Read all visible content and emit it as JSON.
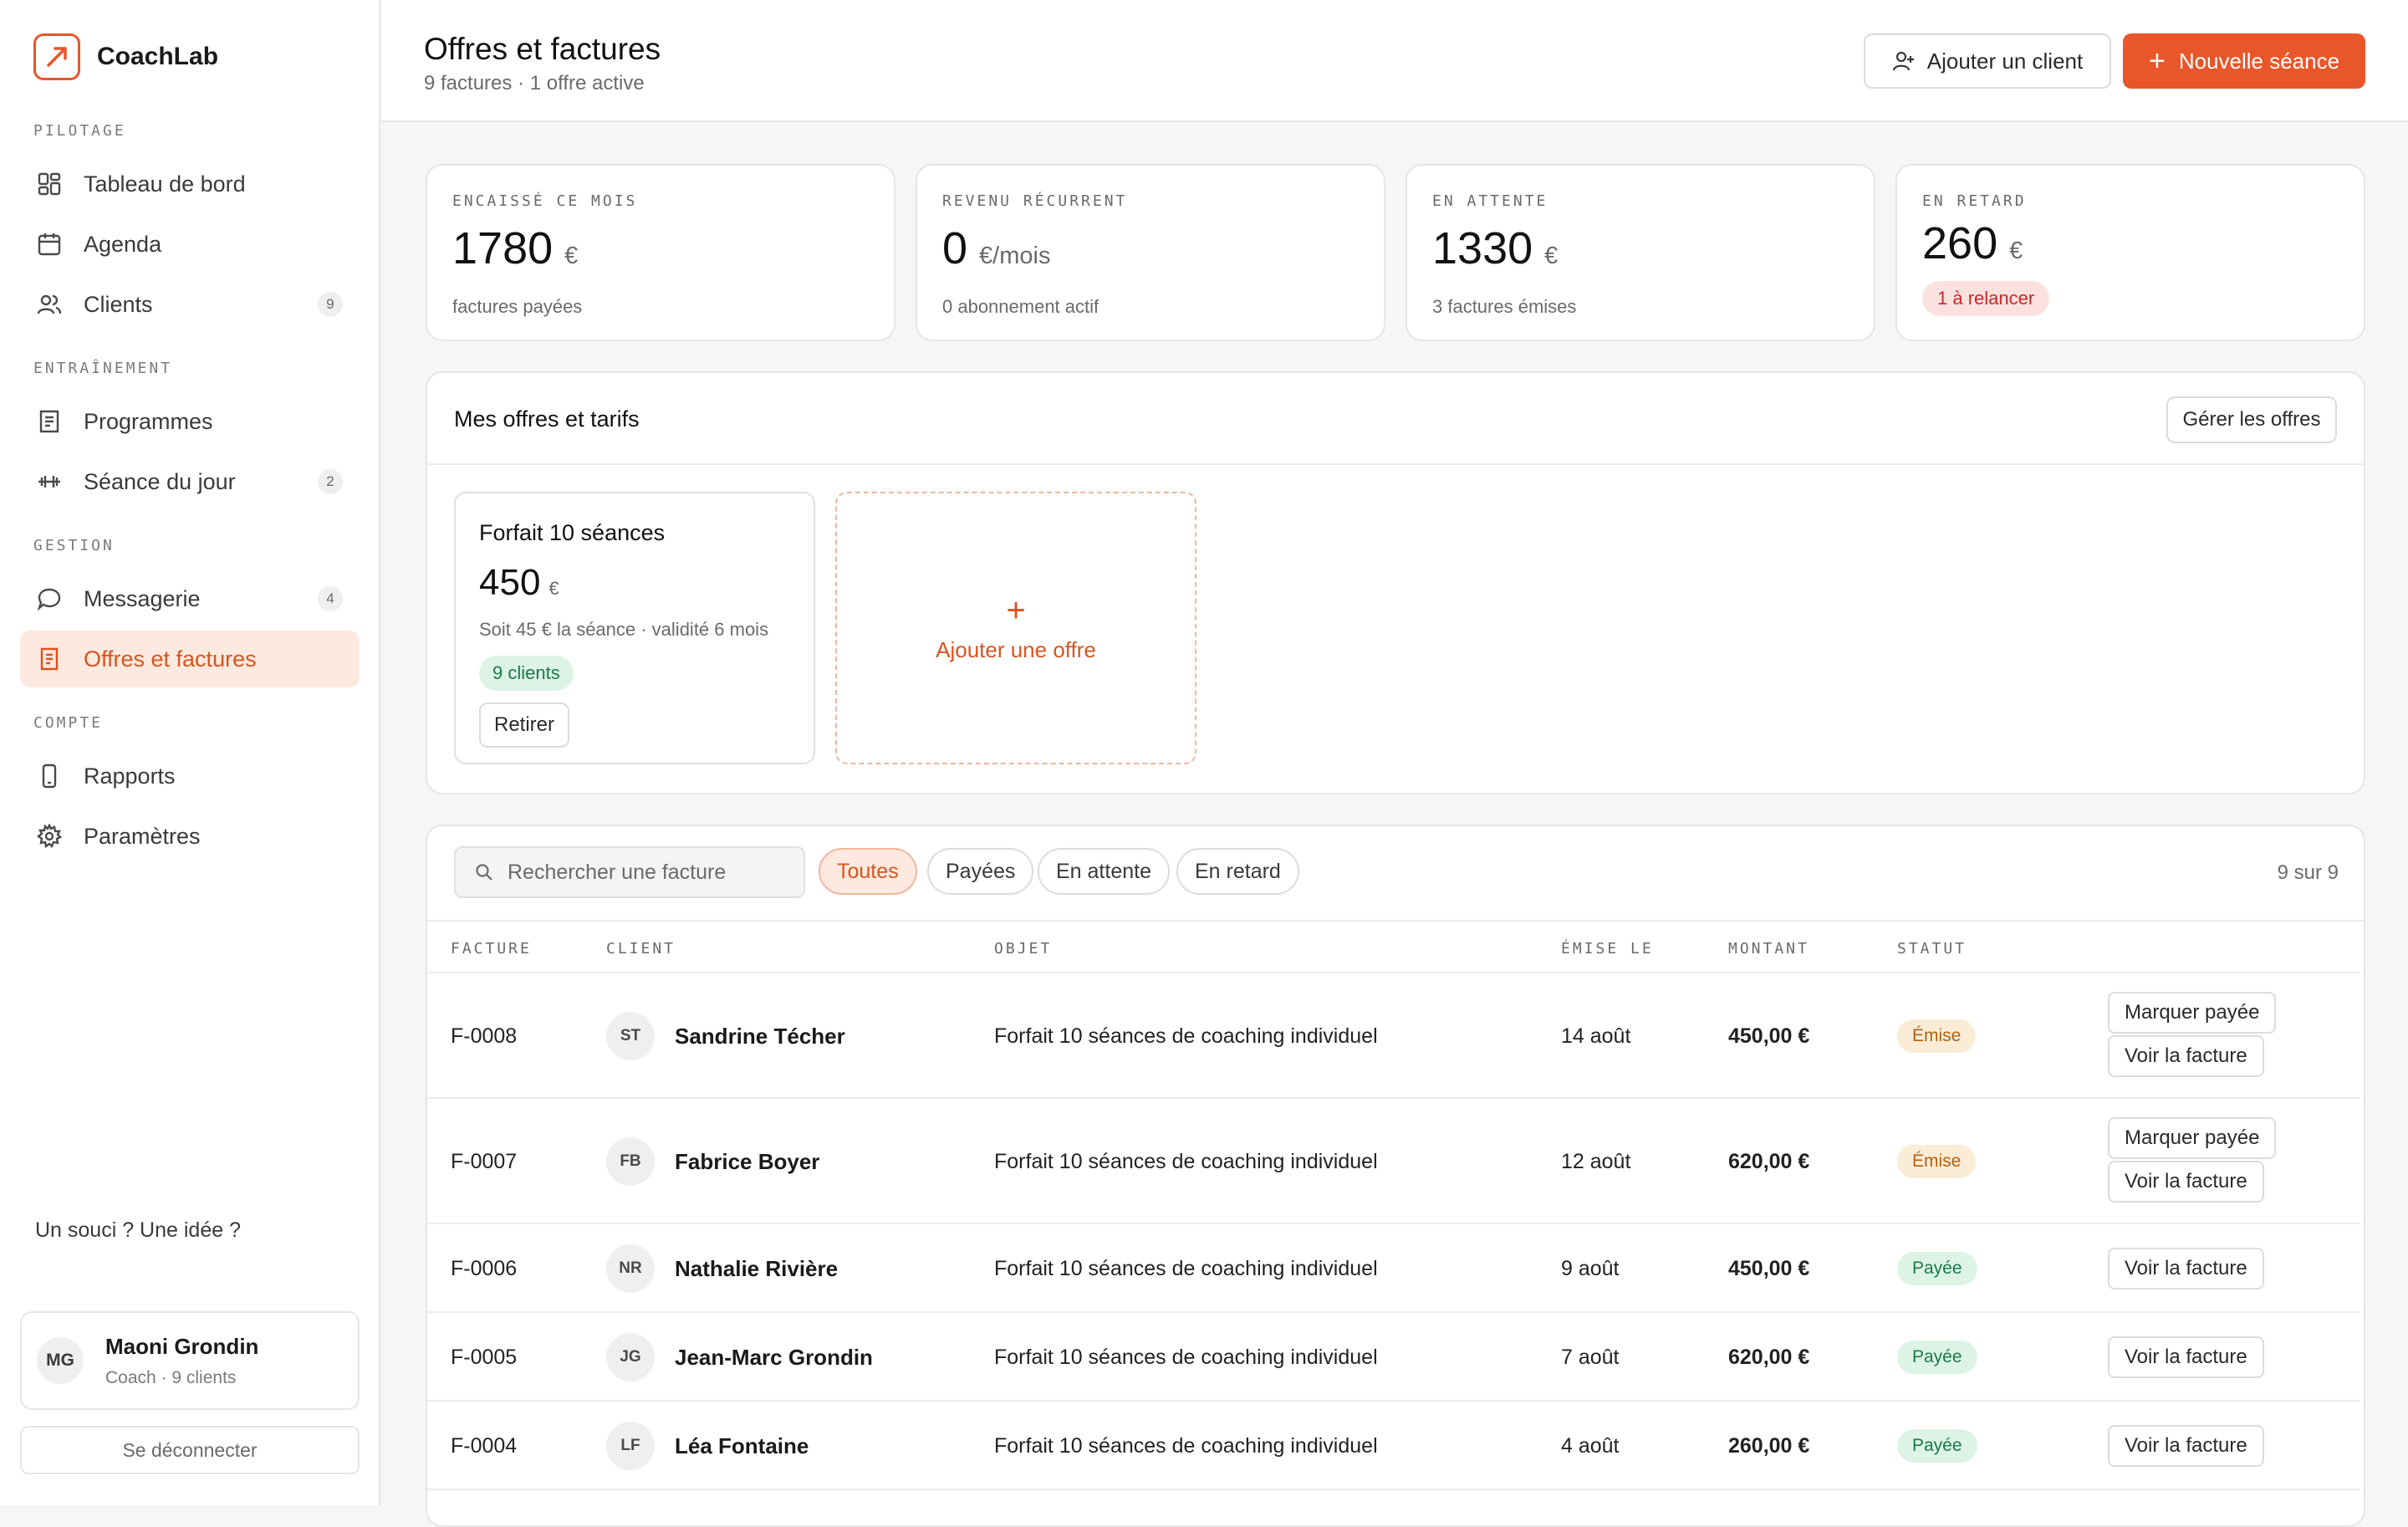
{
  "brand": {
    "name": "CoachLab"
  },
  "sidebar": {
    "sections": [
      {
        "label": "PILOTAGE"
      },
      {
        "label": "ENTRAÎNEMENT"
      },
      {
        "label": "GESTION"
      },
      {
        "label": "COMPTE"
      }
    ],
    "items": [
      {
        "label": "Tableau de bord",
        "icon": "dashboard-icon"
      },
      {
        "label": "Agenda",
        "icon": "calendar-icon"
      },
      {
        "label": "Clients",
        "icon": "users-icon",
        "badge": "9"
      },
      {
        "label": "Programmes",
        "icon": "notebook-icon"
      },
      {
        "label": "Séance du jour",
        "icon": "dumbbell-icon",
        "badge": "2"
      },
      {
        "label": "Messagerie",
        "icon": "chat-icon",
        "badge": "4"
      },
      {
        "label": "Offres et factures",
        "icon": "invoice-icon",
        "active": true
      },
      {
        "label": "Rapports",
        "icon": "phone-icon"
      },
      {
        "label": "Paramètres",
        "icon": "gear-icon"
      }
    ],
    "feedback": "Un souci ? Une idée ?",
    "user": {
      "initials": "MG",
      "name": "Maoni Grondin",
      "role": "Coach · 9 clients"
    },
    "logout": "Se déconnecter"
  },
  "header": {
    "title": "Offres et factures",
    "subtitle": "9 factures · 1 offre active",
    "add_client": "Ajouter un client",
    "new_session": "Nouvelle séance"
  },
  "stats": [
    {
      "label": "ENCAISSÉ CE MOIS",
      "value": "1780",
      "unit": "€",
      "foot": "factures payées"
    },
    {
      "label": "REVENU RÉCURRENT",
      "value": "0",
      "unit": "€/mois",
      "foot": "0 abonnement actif"
    },
    {
      "label": "EN ATTENTE",
      "value": "1330",
      "unit": "€",
      "foot": "3 factures émises"
    },
    {
      "label": "EN RETARD",
      "value": "260",
      "unit": "€",
      "foot": "1 à relancer"
    }
  ],
  "offers": {
    "title": "Mes offres et tarifs",
    "manage": "Gérer les offres",
    "card": {
      "name": "Forfait 10 séances",
      "price": "450",
      "unit": "€",
      "detail": "Soit 45 € la séance · validité 6 mois",
      "clients": "9 clients",
      "retire": "Retirer"
    },
    "add_label": "Ajouter une offre",
    "add_symbol": "+"
  },
  "invoices": {
    "search_placeholder": "Rechercher une facture",
    "filters": [
      "Toutes",
      "Payées",
      "En attente",
      "En retard"
    ],
    "count": "9 sur 9",
    "columns": [
      "FACTURE",
      "CLIENT",
      "OBJET",
      "ÉMISE LE",
      "MONTANT",
      "STATUT"
    ],
    "mark_paid": "Marquer payée",
    "view": "Voir la facture",
    "rows": [
      {
        "id": "F-0008",
        "initials": "ST",
        "client": "Sandrine Técher",
        "object": "Forfait 10 séances de coaching individuel",
        "date": "14 août",
        "amount": "450,00 €",
        "status": "Émise"
      },
      {
        "id": "F-0007",
        "initials": "FB",
        "client": "Fabrice Boyer",
        "object": "Forfait 10 séances de coaching individuel",
        "date": "12 août",
        "amount": "620,00 €",
        "status": "Émise"
      },
      {
        "id": "F-0006",
        "initials": "NR",
        "client": "Nathalie Rivière",
        "object": "Forfait 10 séances de coaching individuel",
        "date": "9 août",
        "amount": "450,00 €",
        "status": "Payée"
      },
      {
        "id": "F-0005",
        "initials": "JG",
        "client": "Jean-Marc Grondin",
        "object": "Forfait 10 séances de coaching individuel",
        "date": "7 août",
        "amount": "620,00 €",
        "status": "Payée"
      },
      {
        "id": "F-0004",
        "initials": "LF",
        "client": "Léa Fontaine",
        "object": "Forfait 10 séances de coaching individuel",
        "date": "4 août",
        "amount": "260,00 €",
        "status": "Payée"
      }
    ]
  },
  "colors": {
    "accent": "#e8562a",
    "accent_soft": "#fde9df",
    "paid": "#1b7a48",
    "issued": "#b0600e",
    "late": "#c62828"
  }
}
